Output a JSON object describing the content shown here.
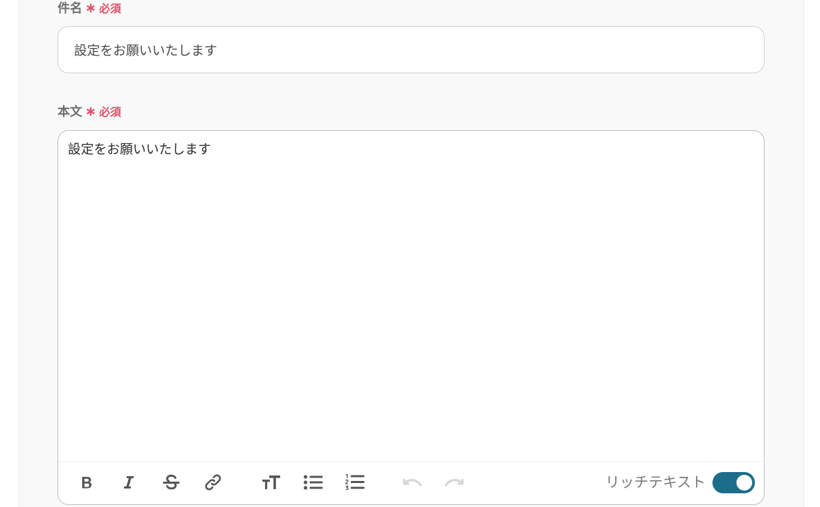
{
  "subject": {
    "label": "件名",
    "required_mark": "∗",
    "required_text": "必須",
    "value": "設定をお願いいたします"
  },
  "body": {
    "label": "本文",
    "required_mark": "∗",
    "required_text": "必須",
    "value": "設定をお願いいたします"
  },
  "toolbar": {
    "buttons": [
      {
        "icon": "bold-icon",
        "state": "enabled"
      },
      {
        "icon": "italic-icon",
        "state": "enabled"
      },
      {
        "icon": "strikethrough-icon",
        "state": "enabled"
      },
      {
        "icon": "link-icon",
        "state": "enabled"
      },
      {
        "icon": "font-size-icon",
        "state": "enabled"
      },
      {
        "icon": "bulleted-list-icon",
        "state": "enabled"
      },
      {
        "icon": "numbered-list-icon",
        "state": "enabled"
      },
      {
        "icon": "undo-icon",
        "state": "disabled"
      },
      {
        "icon": "redo-icon",
        "state": "disabled"
      }
    ],
    "rich_text_label": "リッチテキスト",
    "rich_text_enabled": true
  },
  "colors": {
    "required": "#e0506a",
    "toggle_on": "#1b6d8a",
    "icon": "#555555",
    "icon_disabled": "#d5d5d5"
  }
}
